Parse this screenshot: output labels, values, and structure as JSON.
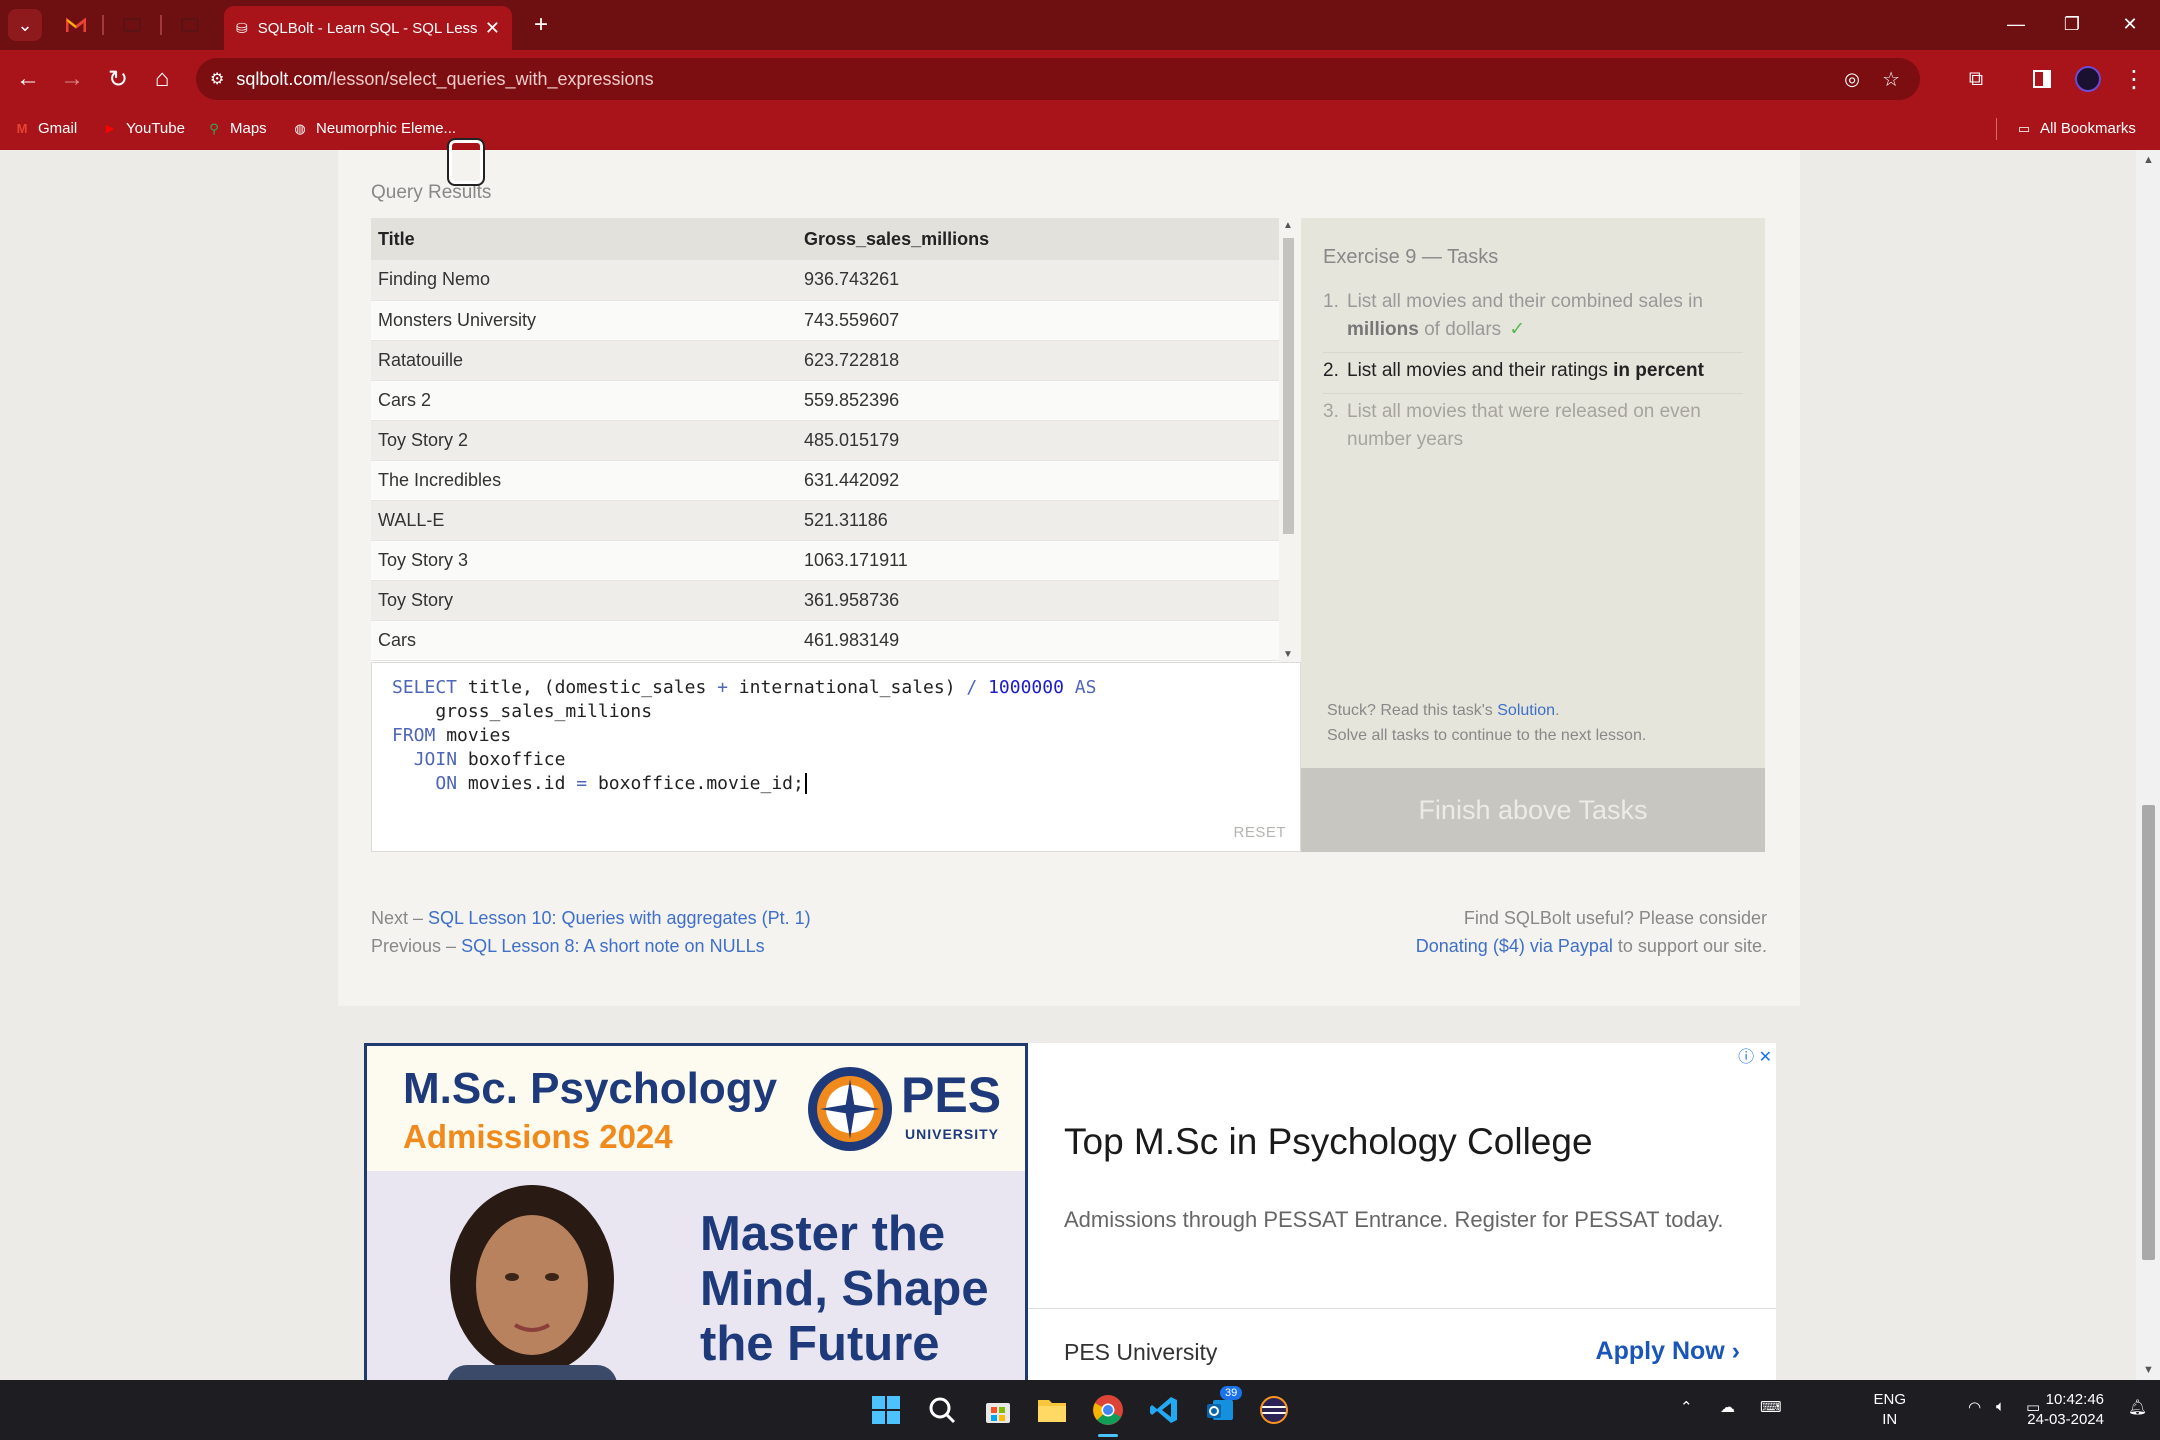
{
  "browser": {
    "active_tab_title": "SQLBolt - Learn SQL - SQL Less",
    "url_host": "sqlbolt.com",
    "url_path": "/lesson/select_queries_with_expressions",
    "bookmarks": [
      "Gmail",
      "YouTube",
      "Maps",
      "Neumorphic Eleme..."
    ],
    "all_bookmarks": "All Bookmarks"
  },
  "results": {
    "label": "Query Results",
    "columns": [
      "Title",
      "Gross_sales_millions"
    ],
    "rows": [
      [
        "Finding Nemo",
        "936.743261"
      ],
      [
        "Monsters University",
        "743.559607"
      ],
      [
        "Ratatouille",
        "623.722818"
      ],
      [
        "Cars 2",
        "559.852396"
      ],
      [
        "Toy Story 2",
        "485.015179"
      ],
      [
        "The Incredibles",
        "631.442092"
      ],
      [
        "WALL-E",
        "521.31186"
      ],
      [
        "Toy Story 3",
        "1063.171911"
      ],
      [
        "Toy Story",
        "361.958736"
      ],
      [
        "Cars",
        "461.983149"
      ]
    ]
  },
  "editor": {
    "reset_label": "RESET"
  },
  "tasks": {
    "header": "Exercise 9 — Tasks",
    "t1_num": "1.",
    "t1_pre": "List all movies and their combined sales in",
    "t1_bold": "millions",
    "t1_post": "of dollars",
    "t1_check": "✓",
    "t2_num": "2.",
    "t2_pre": "List all movies and their ratings",
    "t2_bold": "in percent",
    "t3_num": "3.",
    "t3_text": "List all movies that were released on even number years",
    "stuck_pre": "Stuck? Read this task's",
    "stuck_link": "Solution",
    "stuck_line2": "Solve all tasks to continue to the next lesson.",
    "finish_label": "Finish above Tasks"
  },
  "lesson_nav": {
    "next_prefix": "Next –",
    "next_link": "SQL Lesson 10: Queries with aggregates (Pt. 1)",
    "prev_prefix": "Previous –",
    "prev_link": "SQL Lesson 8: A short note on NULLs",
    "donate_line1": "Find SQLBolt useful? Please consider",
    "donate_link": "Donating ($4) via Paypal",
    "donate_post": "to support our site."
  },
  "ad": {
    "title1": "M.Sc. Psychology",
    "title2": "Admissions 2024",
    "logo_text": "PES",
    "logo_sub": "UNIVERSITY",
    "slogan_1": "Master the",
    "slogan_2": "Mind, Shape",
    "slogan_3": "the Future",
    "headline": "Top M.Sc in Psychology College",
    "desc": "Admissions through PESSAT Entrance. Register for PESSAT today.",
    "brand": "PES University",
    "cta": "Apply Now"
  },
  "taskbar": {
    "lang_1": "ENG",
    "lang_2": "IN",
    "time": "10:42:46",
    "date": "24-03-2024",
    "outlook_badge": "39"
  },
  "colors": {
    "tabbar": "#6e0f12",
    "toolbar": "#a81419",
    "link": "#3f6fc8",
    "sql_keyword": "#4f66b8"
  }
}
